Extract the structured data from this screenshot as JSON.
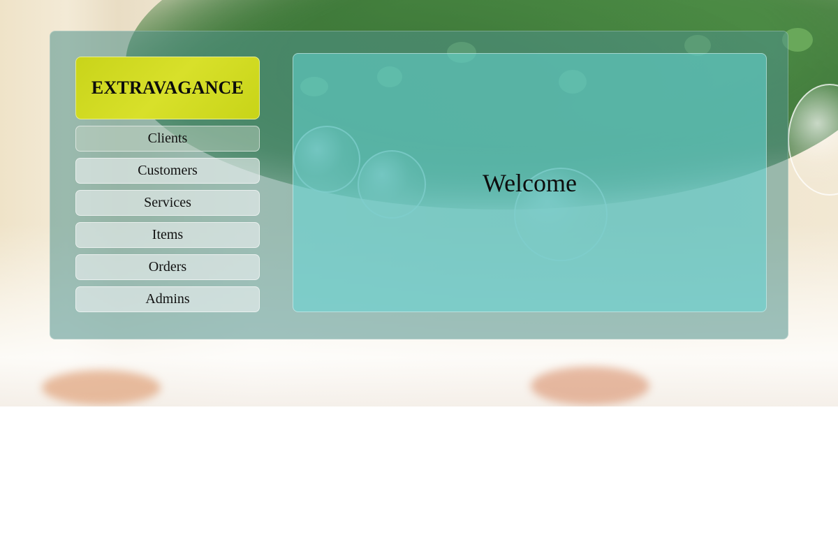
{
  "brand": {
    "name": "EXTRAVAGANCE",
    "accent_color": "#d3dc22"
  },
  "sidebar": {
    "items": [
      {
        "label": "Clients"
      },
      {
        "label": "Customers"
      },
      {
        "label": "Services"
      },
      {
        "label": "Items"
      },
      {
        "label": "Orders"
      },
      {
        "label": "Admins"
      }
    ]
  },
  "main": {
    "heading": "Welcome",
    "panel_color": "#64d7d7"
  },
  "background": {
    "image": "wedding-greenery-photo"
  }
}
